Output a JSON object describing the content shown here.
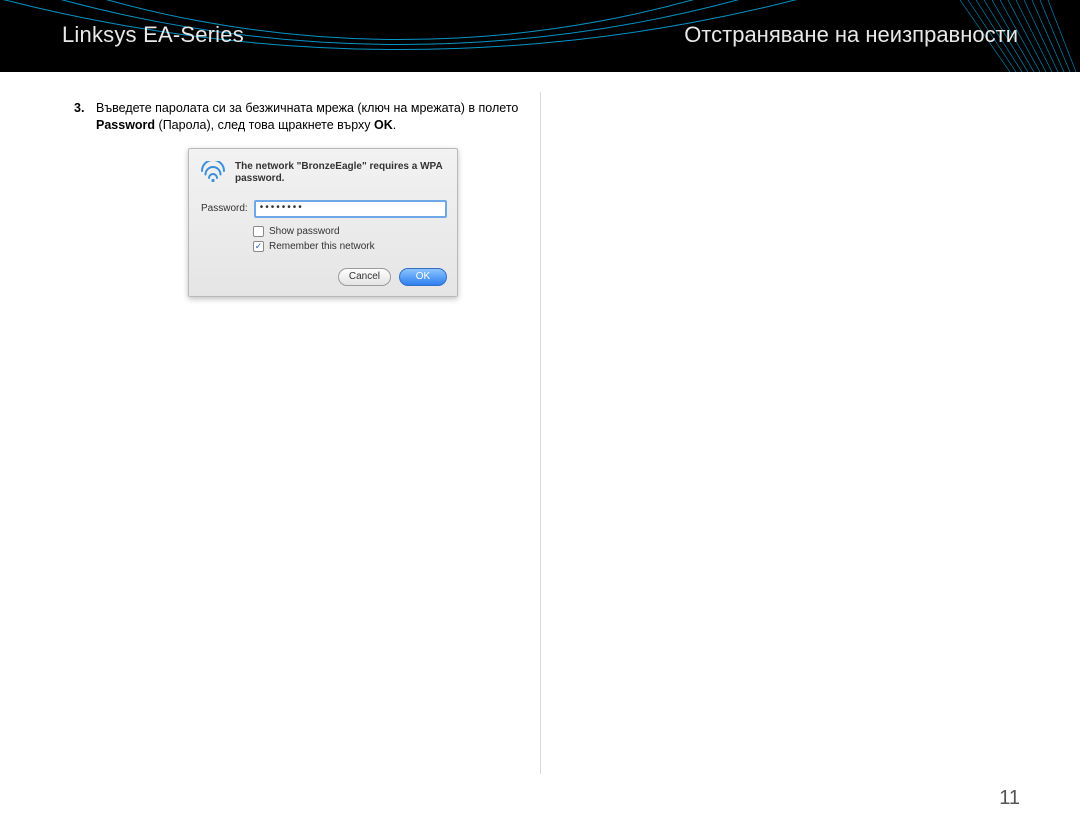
{
  "header": {
    "left_title": "Linksys EA-Series",
    "right_title": "Отстраняване на неизправности"
  },
  "step": {
    "number": "3.",
    "text_before_bold1": "Въведете паролата си за безжичната мрежа (ключ на мрежата) в полето ",
    "bold1": "Password",
    "text_between": " (Парола), след това щракнете върху ",
    "bold2": "OK",
    "text_after": "."
  },
  "dialog": {
    "message": "The network \"BronzeEagle\" requires a WPA password.",
    "password_label": "Password:",
    "password_value": "••••••••",
    "show_password_label": "Show password",
    "show_password_checked": false,
    "remember_label": "Remember this network",
    "remember_checked": true,
    "cancel_label": "Cancel",
    "ok_label": "OK"
  },
  "page_number": "11"
}
